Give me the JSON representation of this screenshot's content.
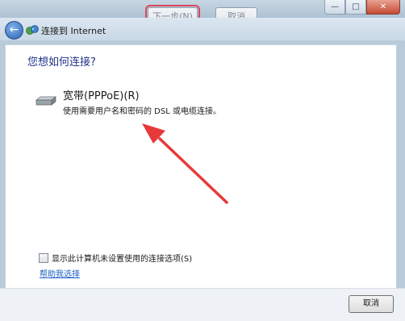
{
  "background": {
    "next_button_label": "下一步(N)",
    "cancel_button_label": "取消"
  },
  "window": {
    "title": "连接到 Internet",
    "controls": {
      "minimize": "—",
      "maximize": "□",
      "close": "✕"
    }
  },
  "main": {
    "question": "您想如何连接?",
    "option": {
      "title": "宽带(PPPoE)(R)",
      "description": "使用需要用户名和密码的 DSL 或电缆连接。",
      "icon": "modem-icon"
    },
    "checkbox": {
      "label": "显示此计算机未设置使用的连接选项(S)",
      "checked": false
    },
    "help_link": "帮助我选择"
  },
  "footer": {
    "cancel_label": "取消"
  },
  "colors": {
    "heading": "#1e3287",
    "link": "#1c5fc6",
    "annotation_arrow": "#e8393a"
  }
}
